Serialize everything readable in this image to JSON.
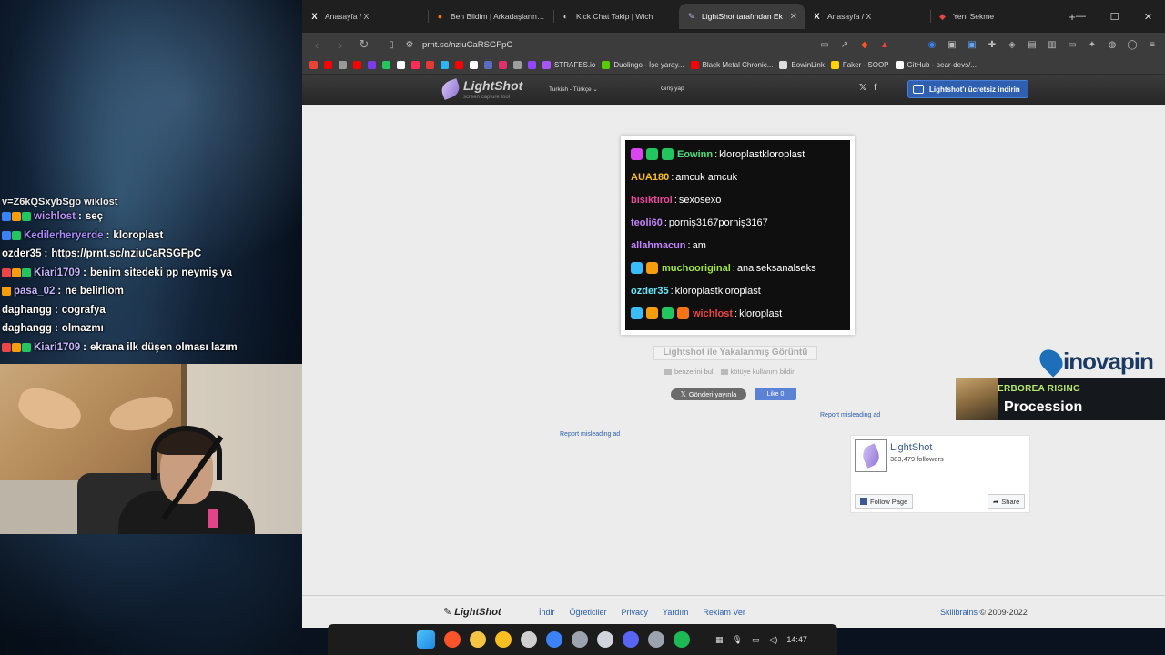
{
  "chat_overlay": {
    "cut_line": "v=Z6kQSxybSgo wiklost",
    "messages": [
      {
        "user": "wichlost",
        "user_color": "#b794f6",
        "badges": [
          "#3b82f6",
          "#f59e0b",
          "#22c55e"
        ],
        "text": "seç"
      },
      {
        "user": "Kedilerheryerde",
        "user_color": "#a78bfa",
        "badges": [
          "#3b82f6",
          "#22c55e"
        ],
        "text": "kloroplast"
      },
      {
        "user": "ozder35",
        "user_color": "#ffffff",
        "badges": [],
        "text": "https://prnt.sc/nziuCaRSGFpC"
      },
      {
        "user": "Kiari1709",
        "user_color": "#c4b5fd",
        "badges": [
          "#ef4444",
          "#f59e0b",
          "#22c55e"
        ],
        "text": "benim sitedeki pp neymiş ya"
      },
      {
        "user": "pasa_02",
        "user_color": "#c4b5fd",
        "badges": [
          "#f59e0b"
        ],
        "text": "ne belirliom"
      },
      {
        "user": "daghangg",
        "user_color": "#ffffff",
        "badges": [],
        "text": "cografya"
      },
      {
        "user": "daghangg",
        "user_color": "#ffffff",
        "badges": [],
        "text": "olmazmı"
      },
      {
        "user": "Kiari1709",
        "user_color": "#c4b5fd",
        "badges": [
          "#ef4444",
          "#f59e0b",
          "#22c55e"
        ],
        "text": "ekrana ilk düşen olması lazım"
      }
    ]
  },
  "browser": {
    "tabs": [
      {
        "label": "Anasayfa / X",
        "icon": "X",
        "icon_color": "#ffffff",
        "active": false
      },
      {
        "label": "Ben Bildim | Arkadaşlarınla O",
        "icon": "●",
        "icon_color": "#f97316",
        "active": false
      },
      {
        "label": "Kick Chat Takip | Wich",
        "icon": "◐",
        "icon_color": "#cccccc",
        "active": false
      },
      {
        "label": "LightShot tarafından Ek",
        "icon": "✎",
        "icon_color": "#b9a3f0",
        "active": true
      },
      {
        "label": "Anasayfa / X",
        "icon": "X",
        "icon_color": "#ffffff",
        "active": false
      },
      {
        "label": "Yeni Sekme",
        "icon": "◆",
        "icon_color": "#ef4444",
        "active": false
      }
    ],
    "url": "prnt.sc/nziuCaRSGFpC",
    "bookmarks": [
      {
        "label": "",
        "color": "#ea4335"
      },
      {
        "label": "",
        "color": "#ff0000"
      },
      {
        "label": "",
        "color": "#999999"
      },
      {
        "label": "",
        "color": "#ff0000"
      },
      {
        "label": "",
        "color": "#7c3aed"
      },
      {
        "label": "",
        "color": "#22c55e"
      },
      {
        "label": "",
        "color": "#ffffff"
      },
      {
        "label": "",
        "color": "#ff2d55"
      },
      {
        "label": "",
        "color": "#e53935"
      },
      {
        "label": "",
        "color": "#29b6f6"
      },
      {
        "label": "",
        "color": "#ff0000"
      },
      {
        "label": "",
        "color": "#ffffff"
      },
      {
        "label": "",
        "color": "#5c6bc0"
      },
      {
        "label": "",
        "color": "#e1306c"
      },
      {
        "label": "",
        "color": "#9e9e9e"
      },
      {
        "label": "",
        "color": "#9146ff"
      },
      {
        "label": "STRAFES.io",
        "color": "#a855f7"
      },
      {
        "label": "Duolingo - İşe yaray...",
        "color": "#58cc02"
      },
      {
        "label": "Black Metal Chronic...",
        "color": "#ff0000"
      },
      {
        "label": "EowinLink",
        "color": "#dddddd"
      },
      {
        "label": "Faker - SOOP",
        "color": "#ffd400"
      },
      {
        "label": "GitHub - pear-devs/...",
        "color": "#ffffff"
      }
    ]
  },
  "lightshot": {
    "logo": "LightShot",
    "logo_sub": "screen capture tool",
    "language": "Turkish - Türkçe",
    "login": "Giriş yap",
    "download_button": "Lightshot'ı ücretsiz indirin",
    "screenshot_lines": [
      {
        "user": "Eowinn",
        "user_color": "#4ade80",
        "badges": [
          "#d946ef",
          "#22c55e",
          "#22c55e"
        ],
        "text": "kloroplastkloroplast"
      },
      {
        "user": "AUA180",
        "user_color": "#fbbf24",
        "badges": [],
        "text": "amcuk amcuk"
      },
      {
        "user": "bisiktirol",
        "user_color": "#ec4899",
        "badges": [],
        "text": "sexosexo"
      },
      {
        "user": "teoli60",
        "user_color": "#c084fc",
        "badges": [],
        "text": "porniş3167porniş3167"
      },
      {
        "user": "allahmacun",
        "user_color": "#c084fc",
        "badges": [],
        "text": "am"
      },
      {
        "user": "muchooriginal",
        "user_color": "#a3e635",
        "badges": [
          "#38bdf8",
          "#f59e0b"
        ],
        "text": "analseksanalseks"
      },
      {
        "user": "ozder35",
        "user_color": "#67e8f9",
        "badges": [],
        "text": "kloroplastkloroplast"
      },
      {
        "user": "wichlost",
        "user_color": "#ef4444",
        "badges": [
          "#38bdf8",
          "#f59e0b",
          "#22c55e",
          "#f97316"
        ],
        "text": "kloroplast"
      }
    ],
    "caption": "Lightshot ile Yakalanmış Görüntü",
    "find_similar": "benzerini bul",
    "report_abuse": "kötüye kullanım bildir",
    "tweet": "Gönderi yayınla",
    "like": "Like 0",
    "misleading_ad_1": "Report misleading ad",
    "misleading_ad_2": "Report misleading ad",
    "fb_page": {
      "name": "LightShot",
      "followers": "383,479 followers",
      "follow": "Follow Page",
      "share": "Share"
    },
    "footer": {
      "logo": "LightShot",
      "links": [
        "İndir",
        "Öğreticiler",
        "Privacy",
        "Yardım",
        "Reklam Ver"
      ],
      "brand": "Skillbrains",
      "copyright": "© 2009-2022"
    }
  },
  "stream_ads": {
    "inova_brand": "inovapin",
    "game_small": "ERBOREA RISING",
    "game_title": "Procession"
  },
  "taskbar": {
    "apps": [
      "#4fc3f7",
      "#fb542b",
      "#f4c542",
      "#fbbf24",
      "#cfcfcf",
      "#3b82f6",
      "#9ca3af",
      "#d1d5db",
      "#5865f2",
      "#9ca3af",
      "#1db954"
    ],
    "time": "14:47"
  }
}
